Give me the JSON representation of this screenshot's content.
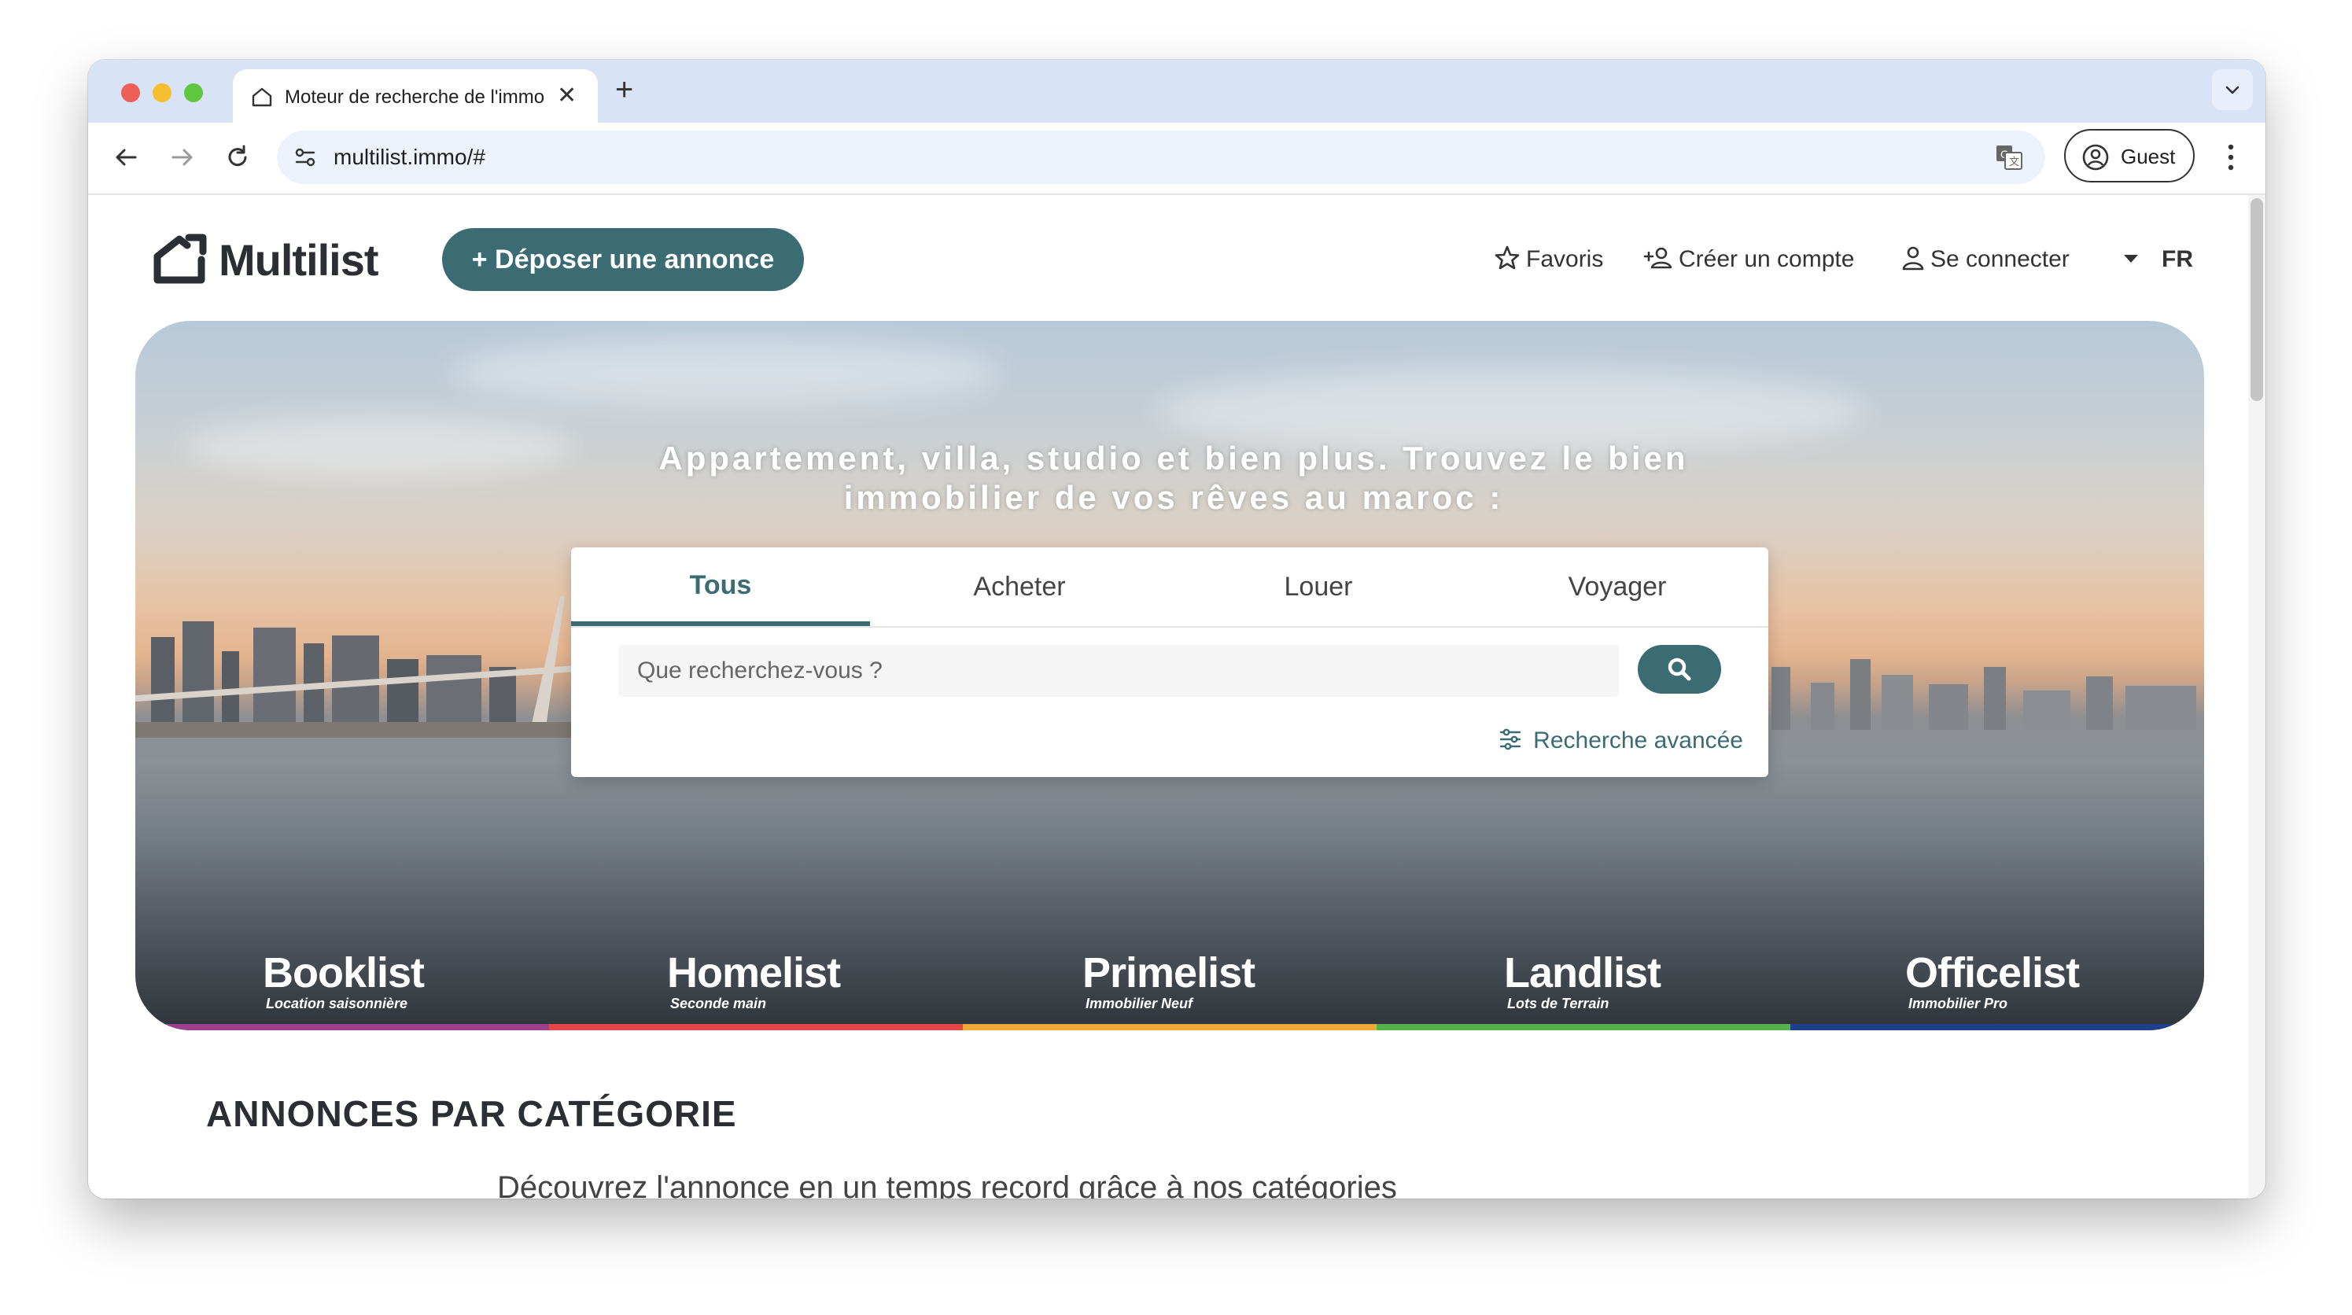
{
  "browser": {
    "tab_title": "Moteur de recherche de l'immobilier",
    "new_tab_label": "+",
    "close_label": "✕",
    "url": "multilist.immo/#",
    "profile_label": "Guest"
  },
  "header": {
    "logo_text": "Multilist",
    "post_button": "+ Déposer une annonce",
    "favorites": "Favoris",
    "create_account": "Créer un compte",
    "login": "Se connecter",
    "language": "FR"
  },
  "hero": {
    "headline_line1": "Appartement, villa, studio et bien plus. Trouvez le bien",
    "headline_line2": "immobilier de vos rêves au maroc :",
    "tabs": [
      "Tous",
      "Acheter",
      "Louer",
      "Voyager"
    ],
    "active_tab": "Tous",
    "search_placeholder": "Que recherchez-vous ?",
    "advanced_search": "Recherche avancée",
    "brands": [
      {
        "name": "Booklist",
        "subtitle": "Location saisonnière",
        "color": "#9c3f8f"
      },
      {
        "name": "Homelist",
        "subtitle": "Seconde main",
        "color": "#e2474a"
      },
      {
        "name": "Primelist",
        "subtitle": "Immobilier Neuf",
        "color": "#f1a93a"
      },
      {
        "name": "Landlist",
        "subtitle": "Lots de Terrain",
        "color": "#55b04e"
      },
      {
        "name": "Officelist",
        "subtitle": "Immobilier Pro",
        "color": "#1e3f8a"
      }
    ]
  },
  "content": {
    "section_title": "ANNONCES PAR CATÉGORIE",
    "section_subtitle": "Découvrez l'annonce en un temps record grâce à nos catégories"
  },
  "colors": {
    "primary": "#3b6b73",
    "whatsapp": "#4cc85a"
  }
}
